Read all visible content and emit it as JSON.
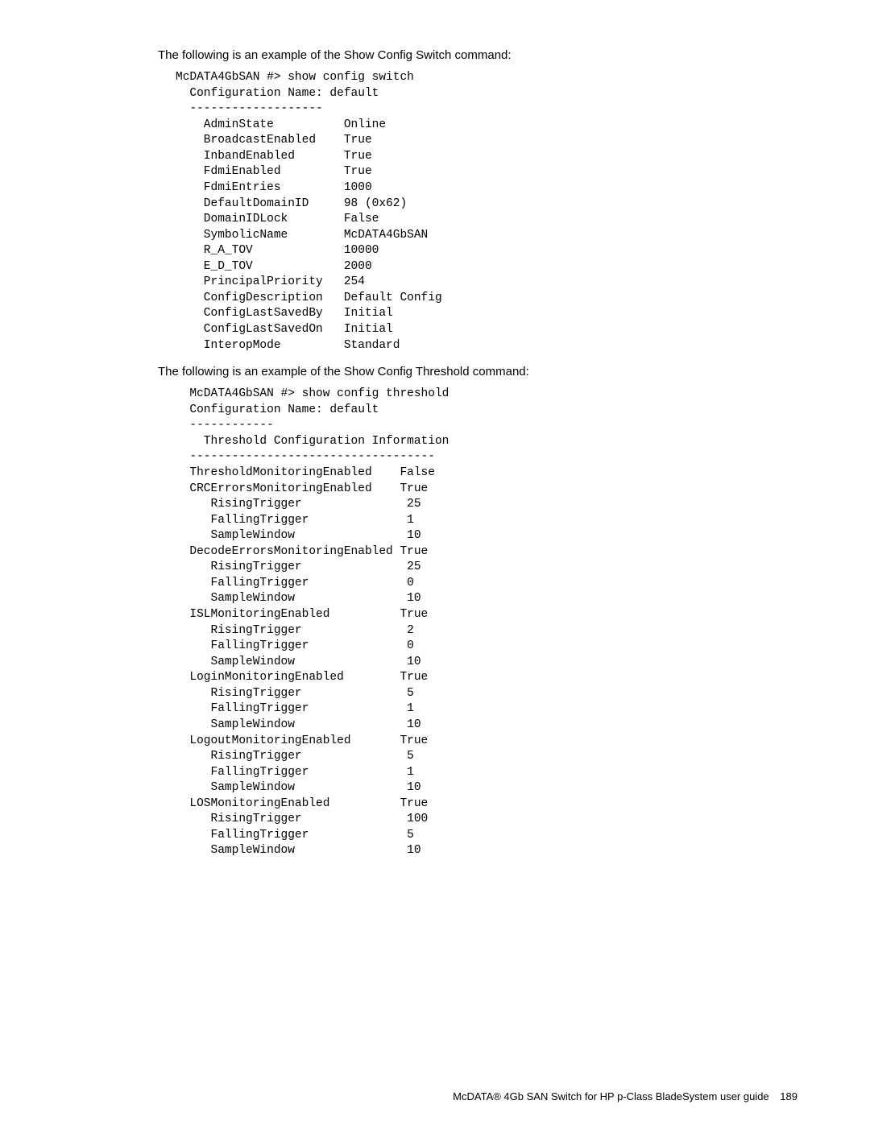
{
  "intro1": "The following is an example of the Show Config Switch command:",
  "block1": "McDATA4GbSAN #> show config switch\n  Configuration Name: default\n  -------------------\n    AdminState          Online\n    BroadcastEnabled    True\n    InbandEnabled       True\n    FdmiEnabled         True\n    FdmiEntries         1000\n    DefaultDomainID     98 (0x62)\n    DomainIDLock        False\n    SymbolicName        McDATA4GbSAN\n    R_A_TOV             10000\n    E_D_TOV             2000\n    PrincipalPriority   254\n    ConfigDescription   Default Config\n    ConfigLastSavedBy   Initial\n    ConfigLastSavedOn   Initial\n    InteropMode         Standard",
  "intro2": "The following is an example of the Show Config Threshold command:",
  "block2": "  McDATA4GbSAN #> show config threshold\n  Configuration Name: default\n  ------------\n    Threshold Configuration Information\n  -----------------------------------\n  ThresholdMonitoringEnabled    False\n  CRCErrorsMonitoringEnabled    True\n     RisingTrigger               25\n     FallingTrigger              1\n     SampleWindow                10\n  DecodeErrorsMonitoringEnabled True\n     RisingTrigger               25\n     FallingTrigger              0\n     SampleWindow                10\n  ISLMonitoringEnabled          True\n     RisingTrigger               2\n     FallingTrigger              0\n     SampleWindow                10\n  LoginMonitoringEnabled        True\n     RisingTrigger               5\n     FallingTrigger              1\n     SampleWindow                10\n  LogoutMonitoringEnabled       True\n     RisingTrigger               5\n     FallingTrigger              1\n     SampleWindow                10\n  LOSMonitoringEnabled          True\n     RisingTrigger               100\n     FallingTrigger              5\n     SampleWindow                10",
  "footer": {
    "title": "McDATA® 4Gb SAN Switch for HP p-Class BladeSystem user guide",
    "page": "189"
  }
}
